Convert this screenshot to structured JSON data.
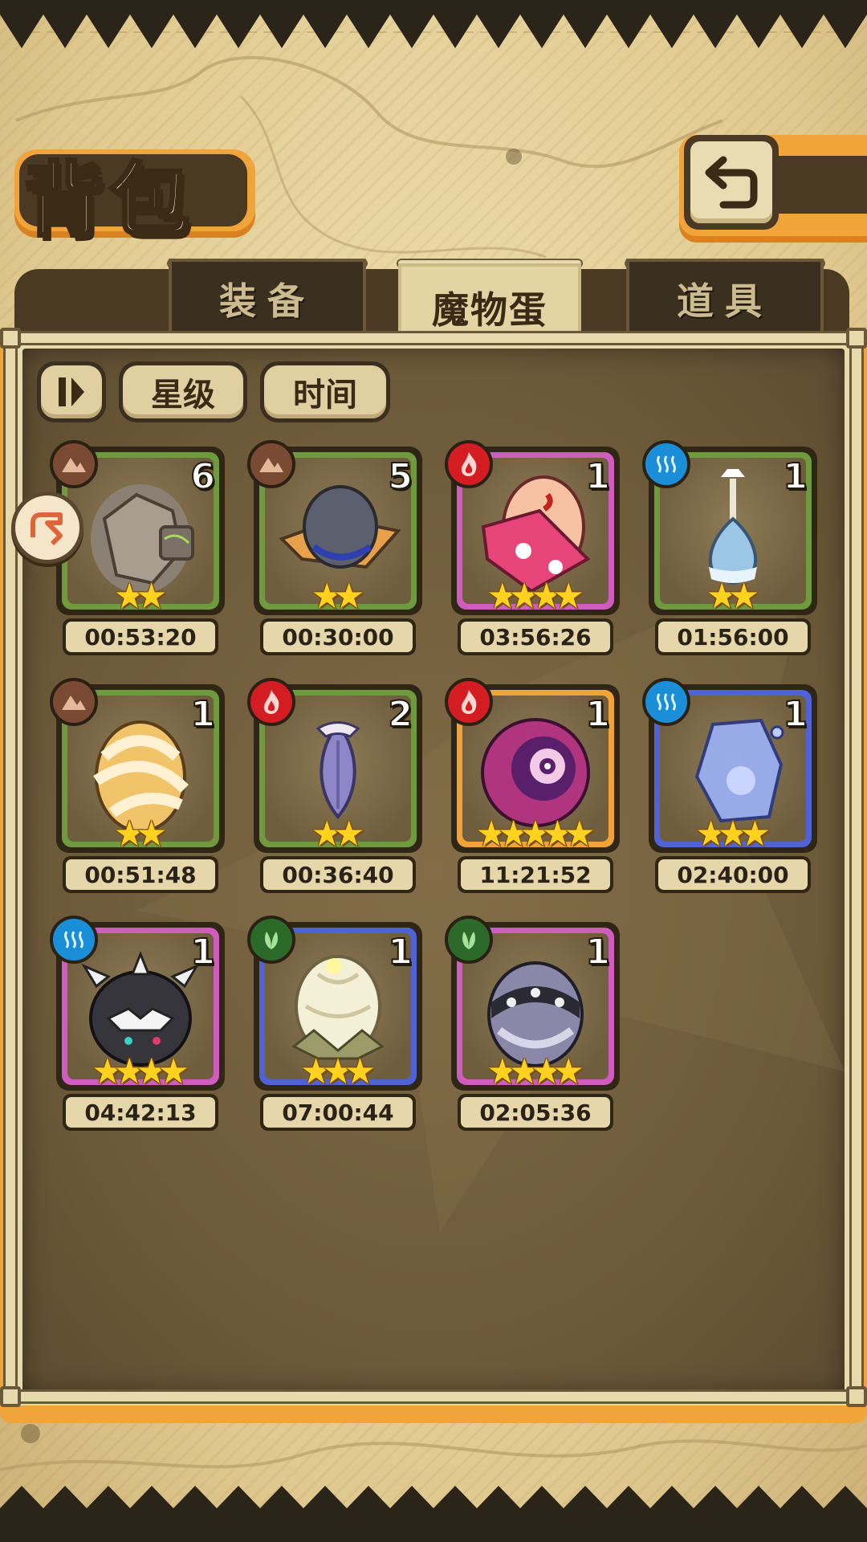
{
  "header": {
    "title": "背包"
  },
  "tabs": [
    {
      "label": "装备",
      "active": false
    },
    {
      "label": "魔物蛋",
      "active": true
    },
    {
      "label": "道具",
      "active": false
    }
  ],
  "filters": {
    "toggle_icon": "pause-bars-icon",
    "star_sort_label": "星级",
    "time_sort_label": "时间"
  },
  "colors": {
    "accent_orange": "#f0a43a",
    "frame_dark": "#4a3a24",
    "rarity_green": "#6f9a3e",
    "rarity_pink": "#d05cc0",
    "rarity_blue": "#4f63d6",
    "rarity_gold": "#f2a338",
    "element_earth": "#7a4a33",
    "element_fire": "#d31d22",
    "element_water": "#1a8fd8",
    "element_wood": "#2c6a2a"
  },
  "eggs": [
    {
      "element": "earth",
      "rarity": "green",
      "count": "6",
      "stars": 2,
      "timer": "00:53:20",
      "icon": "rock-egg-icon"
    },
    {
      "element": "earth",
      "rarity": "green",
      "count": "5",
      "stars": 2,
      "timer": "00:30:00",
      "icon": "hat-egg-icon"
    },
    {
      "element": "fire",
      "rarity": "pink",
      "count": "1",
      "stars": 4,
      "timer": "03:56:26",
      "icon": "kimono-egg-icon"
    },
    {
      "element": "water",
      "rarity": "green",
      "count": "1",
      "stars": 2,
      "timer": "01:56:00",
      "icon": "flask-egg-icon"
    },
    {
      "element": "earth",
      "rarity": "green",
      "count": "1",
      "stars": 2,
      "timer": "00:51:48",
      "icon": "bandage-egg-icon"
    },
    {
      "element": "fire",
      "rarity": "green",
      "count": "2",
      "stars": 2,
      "timer": "00:36:40",
      "icon": "bud-egg-icon"
    },
    {
      "element": "fire",
      "rarity": "gold",
      "count": "1",
      "stars": 5,
      "timer": "11:21:52",
      "icon": "eye-orb-egg-icon"
    },
    {
      "element": "water",
      "rarity": "blue",
      "count": "1",
      "stars": 3,
      "timer": "02:40:00",
      "icon": "ice-crystal-egg-icon"
    },
    {
      "element": "water",
      "rarity": "pink",
      "count": "1",
      "stars": 4,
      "timer": "04:42:13",
      "icon": "spiked-black-egg-icon"
    },
    {
      "element": "wood",
      "rarity": "blue",
      "count": "1",
      "stars": 3,
      "timer": "07:00:44",
      "icon": "lotus-egg-icon"
    },
    {
      "element": "wood",
      "rarity": "pink",
      "count": "1",
      "stars": 4,
      "timer": "02:05:36",
      "icon": "studded-egg-icon"
    }
  ]
}
